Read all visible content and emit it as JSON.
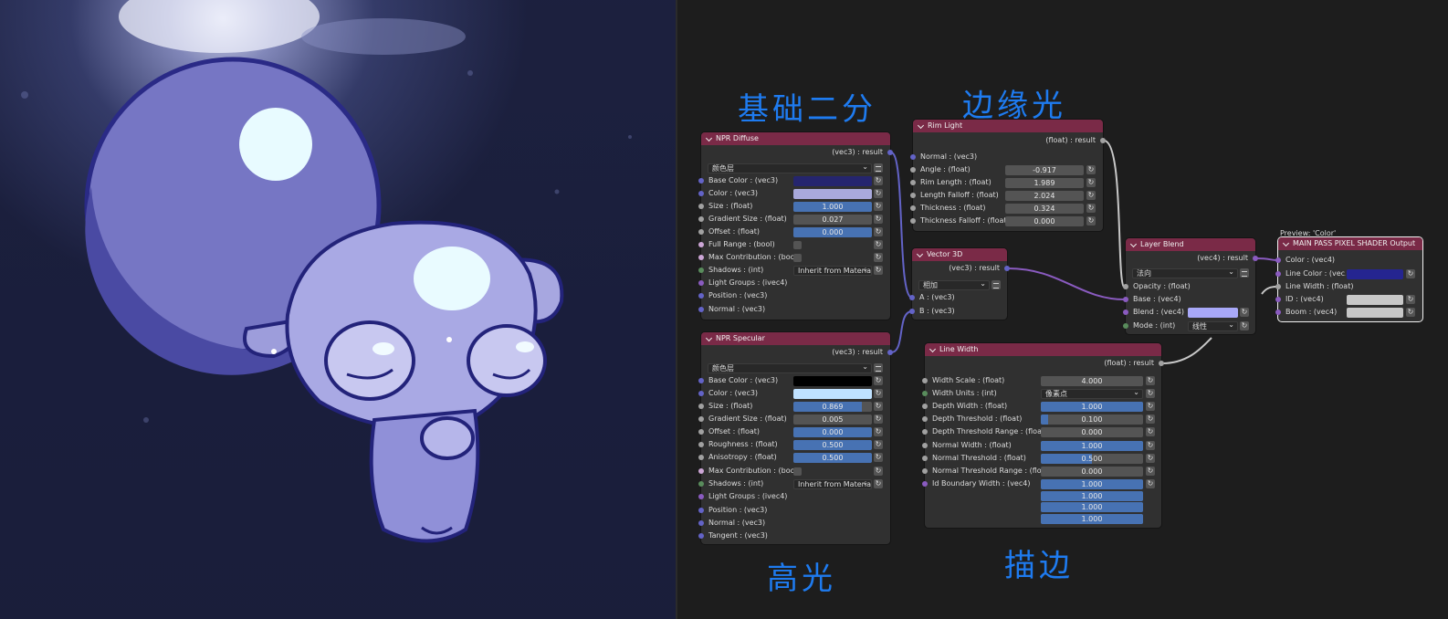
{
  "headings": {
    "diffuse": "基础二分",
    "rim": "边缘光",
    "specular": "高光",
    "outline": "描边"
  },
  "preview_label": "Preview: 'Color'",
  "nodes": {
    "npr_diffuse": {
      "title": "NPR Diffuse",
      "output": "(vec3) : result",
      "mode": "颜色层",
      "inputs": {
        "base_color": "Base Color : (vec3)",
        "color": "Color : (vec3)",
        "size": "Size : (float)",
        "size_value": "1.000",
        "gradient_size": "Gradient Size : (float)",
        "gradient_size_value": "0.027",
        "offset": "Offset : (float)",
        "offset_value": "0.000",
        "full_range": "Full Range : (bool)",
        "max_contribution": "Max Contribution : (bool)",
        "shadows": "Shadows : (int)",
        "shadows_value": "Inherit from Material",
        "light_groups": "Light Groups : (ivec4)",
        "position": "Position : (vec3)",
        "normal": "Normal : (vec3)"
      }
    },
    "rim_light": {
      "title": "Rim Light",
      "output": "(float) : result",
      "inputs": {
        "normal": "Normal : (vec3)",
        "angle": "Angle : (float)",
        "angle_value": "-0.917",
        "rim_length": "Rim Length : (float)",
        "rim_length_value": "1.989",
        "length_falloff": "Length Falloff : (float)",
        "length_falloff_value": "2.024",
        "thickness": "Thickness : (float)",
        "thickness_value": "0.324",
        "thickness_falloff": "Thickness Falloff : (float)",
        "thickness_falloff_value": "0.000"
      }
    },
    "vector_3d": {
      "title": "Vector 3D",
      "output": "(vec3) : result",
      "mode": "相加",
      "inputs": {
        "a": "A : (vec3)",
        "b": "B : (vec3)"
      }
    },
    "npr_specular": {
      "title": "NPR Specular",
      "output": "(vec3) : result",
      "mode": "颜色层",
      "inputs": {
        "base_color": "Base Color : (vec3)",
        "color": "Color : (vec3)",
        "size": "Size : (float)",
        "size_value": "0.869",
        "gradient_size": "Gradient Size : (float)",
        "gradient_size_value": "0.005",
        "offset": "Offset : (float)",
        "offset_value": "0.000",
        "roughness": "Roughness : (float)",
        "roughness_value": "0.500",
        "anisotropy": "Anisotropy : (float)",
        "anisotropy_value": "0.500",
        "max_contribution": "Max Contribution : (bool)",
        "shadows": "Shadows : (int)",
        "shadows_value": "Inherit from Material",
        "light_groups": "Light Groups : (ivec4)",
        "position": "Position : (vec3)",
        "normal": "Normal : (vec3)",
        "tangent": "Tangent : (vec3)"
      }
    },
    "layer_blend": {
      "title": "Layer Blend",
      "output": "(vec4) : result",
      "mode": "法向",
      "inputs": {
        "opacity": "Opacity : (float)",
        "base": "Base : (vec4)",
        "blend": "Blend : (vec4)",
        "mode_label": "Mode : (int)",
        "mode_value": "线性"
      }
    },
    "line_width": {
      "title": "Line Width",
      "output": "(float) : result",
      "inputs": {
        "width_scale": "Width Scale : (float)",
        "width_scale_value": "4.000",
        "width_units": "Width Units : (int)",
        "width_units_value": "像素点",
        "depth_width": "Depth Width : (float)",
        "depth_width_value": "1.000",
        "depth_threshold": "Depth Threshold : (float)",
        "depth_threshold_value": "0.100",
        "depth_threshold_range": "Depth Threshold Range : (float)",
        "depth_threshold_range_value": "0.000",
        "normal_width": "Normal Width : (float)",
        "normal_width_value": "1.000",
        "normal_threshold": "Normal Threshold : (float)",
        "normal_threshold_value": "0.500",
        "normal_threshold_range": "Normal Threshold Range : (float)",
        "normal_threshold_range_value": "0.000",
        "id_boundary_width": "Id Boundary Width : (vec4)",
        "id_values": [
          "1.000",
          "1.000",
          "1.000",
          "1.000"
        ]
      }
    },
    "main_pass": {
      "title": "MAIN PASS PIXEL SHADER Output",
      "inputs": {
        "color": "Color : (vec4)",
        "line_color": "Line Color : (vec...",
        "line_width": "Line Width : (float)",
        "id": "ID : (vec4)",
        "boom": "Boom : (vec4)"
      }
    }
  },
  "colors": {
    "heading": "#1e7bf0",
    "node_header": "#7a2a47",
    "diffuse_base_color": "#25256e",
    "diffuse_color": "#a9a9dc",
    "specular_base_color": "#000000",
    "specular_color": "#bfe1ff",
    "blend_color": "#a8a8f8",
    "line_color": "#252590",
    "id_color": "#c8c8c8",
    "boom_color": "#c8c8c8"
  },
  "icons": [
    "chevron-down-icon",
    "link-socket-icon",
    "menu-icon"
  ]
}
